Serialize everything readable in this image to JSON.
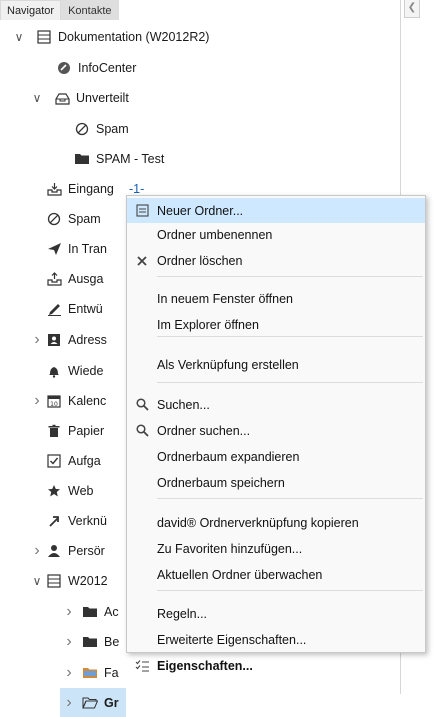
{
  "tabs": [
    {
      "label": "Navigator"
    },
    {
      "label": "Kontakte"
    }
  ],
  "tree": [
    {
      "label": "Dokumentation (W2012R2)",
      "icon": "list-icon",
      "arrow": "chevron-down"
    },
    {
      "label": "InfoCenter",
      "icon": "infocenter-icon"
    },
    {
      "label": "Unverteilt",
      "icon": "tray-icon",
      "arrow": "chevron-down"
    },
    {
      "label": "Spam",
      "icon": "prohibited-icon"
    },
    {
      "label": "SPAM - Test",
      "icon": "folder-icon"
    },
    {
      "label": "Eingang",
      "count": "-1-",
      "icon": "inbox-icon"
    },
    {
      "label": "Spam",
      "icon": "prohibited-icon"
    },
    {
      "label": "In Tran",
      "icon": "send-icon"
    },
    {
      "label": "Ausga",
      "icon": "outbox-icon"
    },
    {
      "label": "Entwü",
      "icon": "draft-icon"
    },
    {
      "label": "Adress",
      "icon": "address-book-icon",
      "arrow": "chevron-right"
    },
    {
      "label": "Wiede",
      "icon": "bell-icon"
    },
    {
      "label": "Kalenc",
      "icon": "calendar-icon",
      "arrow": "chevron-right"
    },
    {
      "label": "Papier",
      "icon": "trash-icon"
    },
    {
      "label": "Aufga",
      "icon": "checkbox-icon"
    },
    {
      "label": "Web",
      "icon": "star-icon"
    },
    {
      "label": "Verknü",
      "icon": "link-icon"
    },
    {
      "label": "Persör",
      "icon": "person-icon",
      "arrow": "chevron-right"
    },
    {
      "label": "W2012",
      "icon": "list-icon",
      "arrow": "chevron-down"
    },
    {
      "label": "Ac",
      "icon": "folder-icon",
      "arrow": "chevron-right"
    },
    {
      "label": "Be",
      "icon": "folder-icon",
      "arrow": "chevron-right"
    },
    {
      "label": "Fa",
      "icon": "folder-colored-icon",
      "arrow": "chevron-right"
    },
    {
      "label": "Gr",
      "icon": "folder-open-icon",
      "arrow": "chevron-right"
    }
  ],
  "context_menu": {
    "items": [
      {
        "type": "item",
        "label": "Neuer Ordner...",
        "icon": "new-folder-icon",
        "highlight": true
      },
      {
        "type": "item",
        "label": "Ordner umbenennen"
      },
      {
        "type": "item",
        "label": "Ordner löschen",
        "icon": "delete-x-icon"
      },
      {
        "type": "sep"
      },
      {
        "type": "item",
        "label": "In neuem Fenster öffnen"
      },
      {
        "type": "item",
        "label": "Im Explorer öffnen"
      },
      {
        "type": "sep"
      },
      {
        "type": "item",
        "label": "Als Verknüpfung erstellen"
      },
      {
        "type": "sep"
      },
      {
        "type": "item",
        "label": "Suchen...",
        "icon": "search-icon"
      },
      {
        "type": "item",
        "label": "Ordner suchen...",
        "icon": "search-icon"
      },
      {
        "type": "item",
        "label": "Ordnerbaum expandieren"
      },
      {
        "type": "item",
        "label": "Ordnerbaum speichern"
      },
      {
        "type": "sep"
      },
      {
        "type": "item",
        "label": "david® Ordnerverknüpfung kopieren"
      },
      {
        "type": "item",
        "label": "Zu Favoriten hinzufügen..."
      },
      {
        "type": "item",
        "label": "Aktuellen Ordner überwachen"
      },
      {
        "type": "sep"
      },
      {
        "type": "item",
        "label": "Regeln..."
      },
      {
        "type": "item",
        "label": "Erweiterte Eigenschaften..."
      },
      {
        "type": "item",
        "label": "Eigenschaften...",
        "icon": "properties-icon",
        "bold": true
      }
    ]
  }
}
